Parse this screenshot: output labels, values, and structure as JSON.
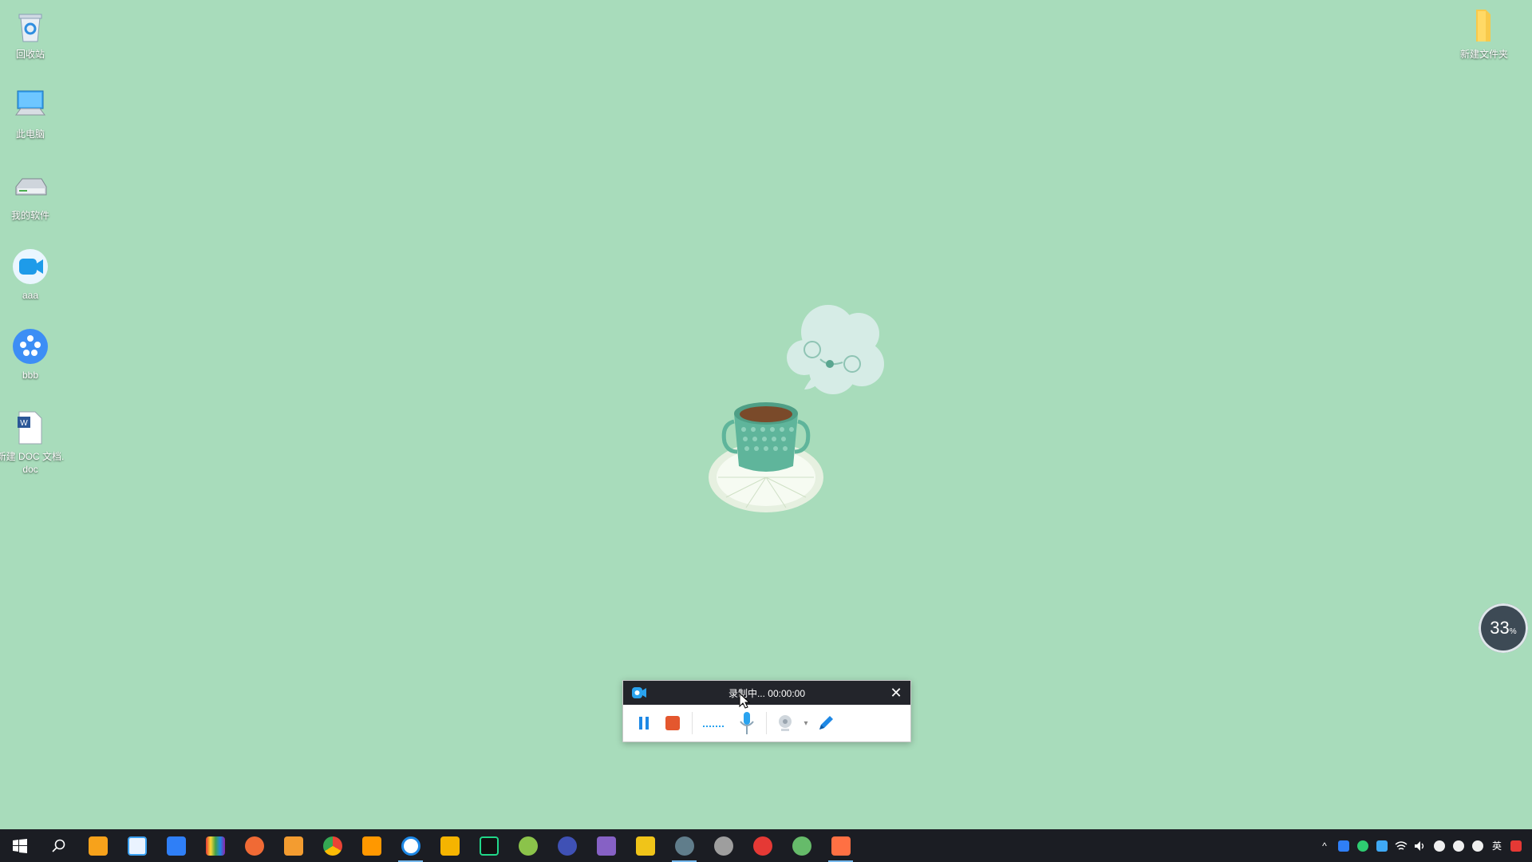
{
  "desktop": {
    "icons": [
      {
        "label": "回收站",
        "icon": "recycle-bin-icon"
      },
      {
        "label": "此电脑",
        "icon": "computer-icon"
      },
      {
        "label": "我的软件",
        "icon": "drive-icon"
      },
      {
        "label": "aaa",
        "icon": "video-camera-app-icon"
      },
      {
        "label": "bbb",
        "icon": "film-reel-app-icon"
      },
      {
        "label": "新建 DOC 文档.doc",
        "icon": "word-document-icon"
      },
      {
        "label": "新建文件夹",
        "icon": "folder-icon"
      }
    ]
  },
  "recorder": {
    "status": "录制中... 00:00:00",
    "tools": [
      "pause-icon",
      "stop-icon",
      "audio-level-icon",
      "microphone-icon",
      "webcam-icon",
      "pen-icon"
    ]
  },
  "meter": {
    "value": "33",
    "unit": "%"
  },
  "taskbar": {
    "apps": [
      {
        "icon": "start-icon",
        "color": "#ffffff"
      },
      {
        "icon": "search-icon",
        "color": "#ffffff"
      },
      {
        "icon": "app-icon",
        "color": "#f7a21b"
      },
      {
        "icon": "app-icon",
        "color": "#3aa0f0"
      },
      {
        "icon": "app-icon",
        "color": "#2f7ff7"
      },
      {
        "icon": "app-icon",
        "color": "#e84d8a"
      },
      {
        "icon": "app-icon",
        "color": "#f06a35"
      },
      {
        "icon": "app-icon",
        "color": "#f39c30"
      },
      {
        "icon": "chrome-icon",
        "color": "#4caf50"
      },
      {
        "icon": "app-icon",
        "color": "#ff9800"
      },
      {
        "icon": "app-icon",
        "color": "#1e88e5"
      },
      {
        "icon": "app-icon",
        "color": "#f5b400"
      },
      {
        "icon": "pycharm-icon",
        "color": "#21d789"
      },
      {
        "icon": "app-icon",
        "color": "#8bc34a"
      },
      {
        "icon": "app-icon",
        "color": "#3f51b5"
      },
      {
        "icon": "visual-studio-icon",
        "color": "#8661c5"
      },
      {
        "icon": "app-icon",
        "color": "#f0c419"
      },
      {
        "icon": "app-icon",
        "color": "#607d8b"
      },
      {
        "icon": "app-icon",
        "color": "#9e9e9e"
      },
      {
        "icon": "app-icon",
        "color": "#e53935"
      },
      {
        "icon": "app-icon",
        "color": "#66bb6a"
      },
      {
        "icon": "app-icon",
        "color": "#ff7043"
      }
    ],
    "tray": {
      "ime": "英"
    }
  }
}
